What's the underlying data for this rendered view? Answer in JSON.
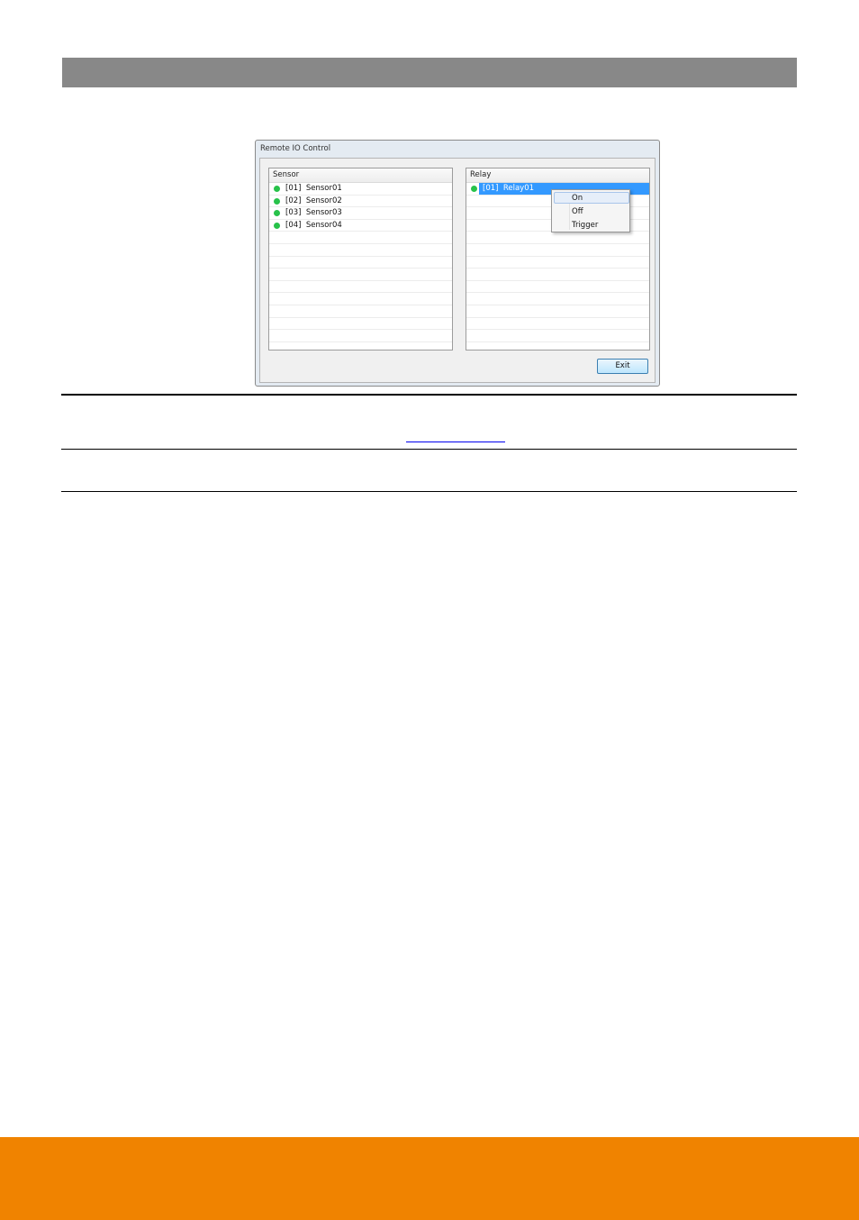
{
  "window": {
    "title": "Remote IO Control"
  },
  "sensor_panel": {
    "header": "Sensor",
    "items": [
      {
        "label": "[01]  Sensor01"
      },
      {
        "label": "[02]  Sensor02"
      },
      {
        "label": "[03]  Sensor03"
      },
      {
        "label": "[04]  Sensor04"
      }
    ]
  },
  "relay_panel": {
    "header": "Relay",
    "items": [
      {
        "label": "[01]  Relay01"
      }
    ]
  },
  "context_menu": {
    "items": [
      "On",
      "Off",
      "Trigger"
    ]
  },
  "buttons": {
    "exit": "Exit"
  },
  "colors": {
    "header_bar": "#888888",
    "footer_bar": "#f08300",
    "status_dot": "#27c24a",
    "selection": "#3399ff"
  },
  "icons": {
    "status": "status-dot-icon"
  }
}
